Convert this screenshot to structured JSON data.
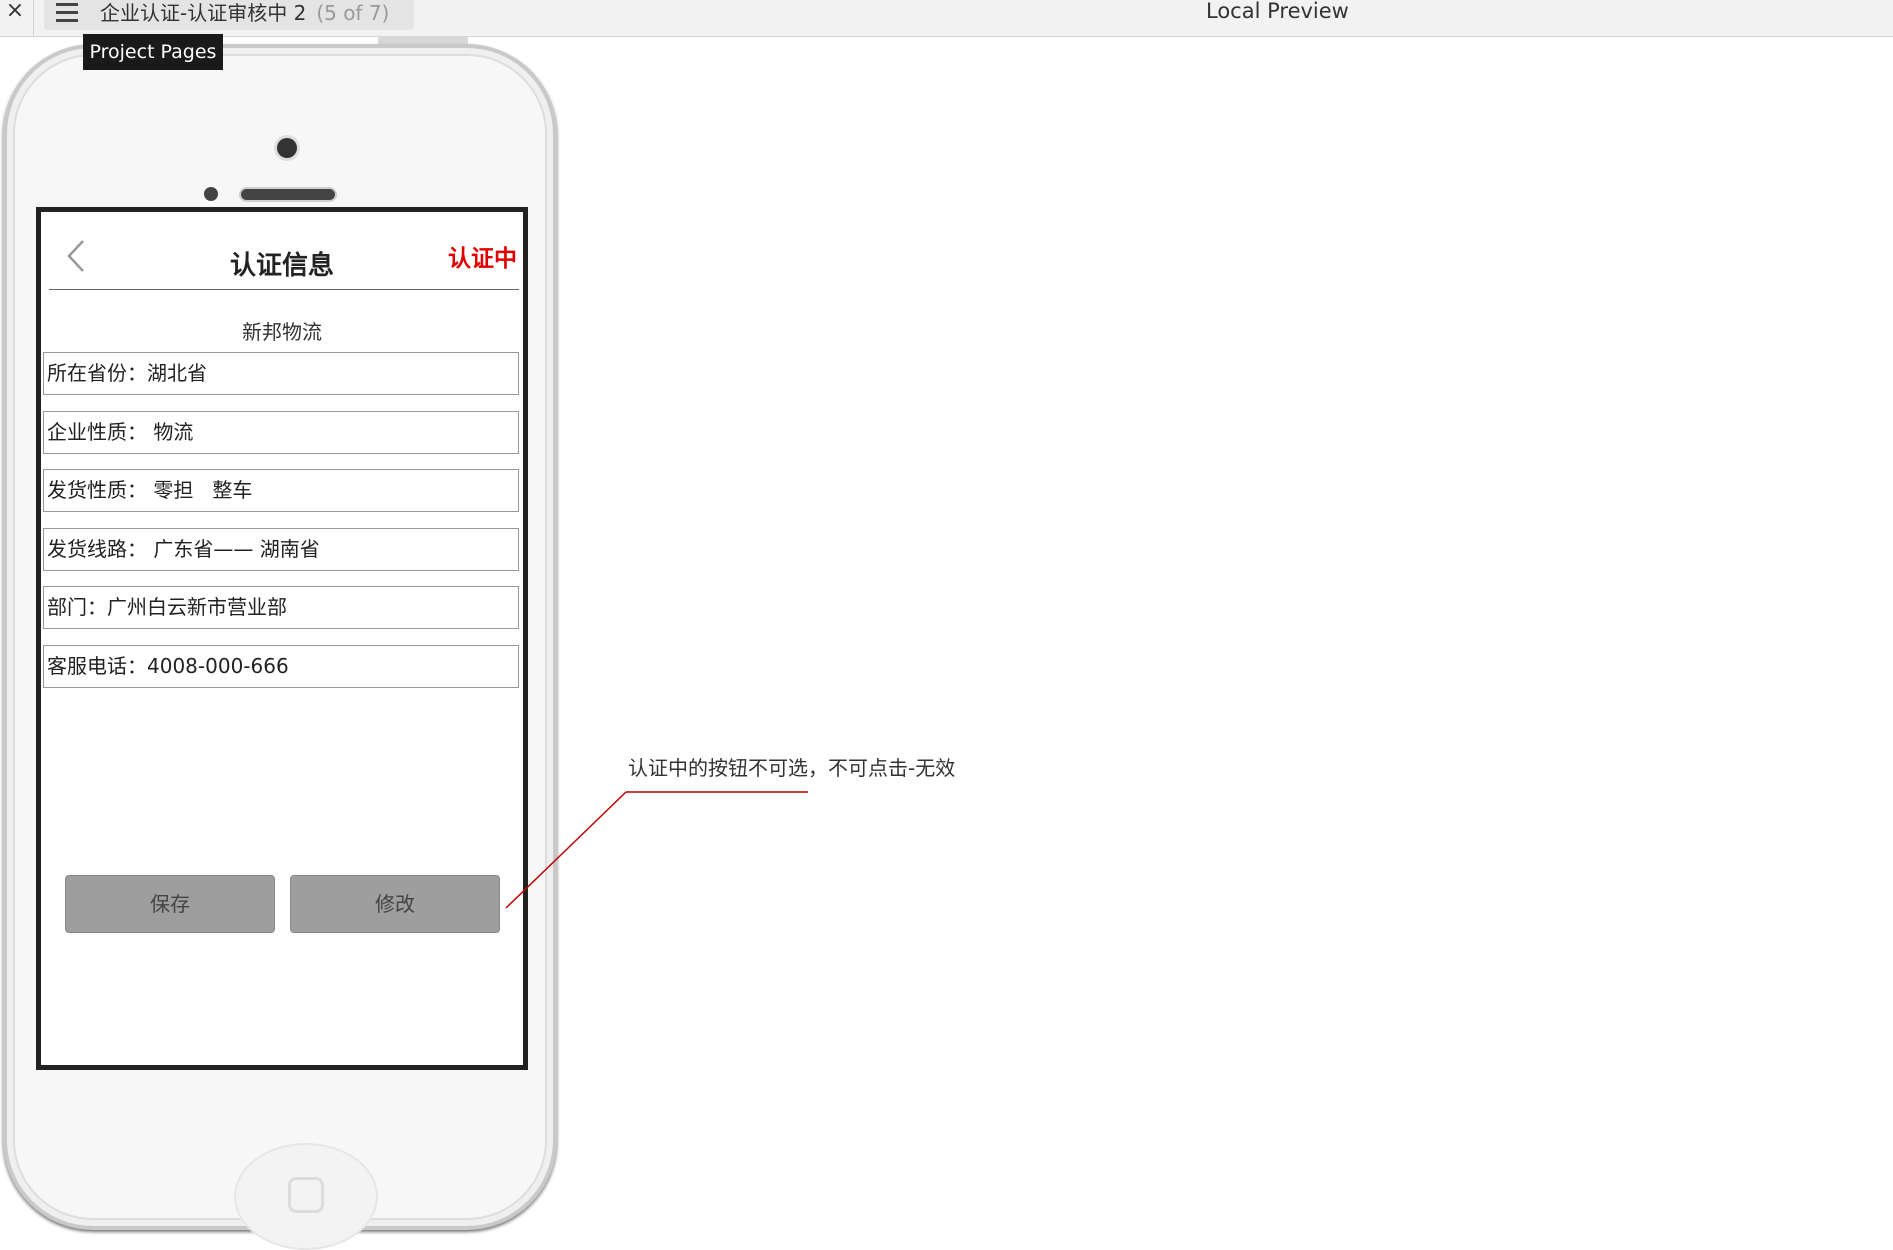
{
  "toolbar": {
    "close_glyph": "×",
    "page_title": "企业认证-认证审核中 2",
    "page_count": "(5 of 7)",
    "preview_label": "Local Preview",
    "tooltip": "Project Pages"
  },
  "screen": {
    "title": "认证信息",
    "status": "认证中",
    "status_color": "#e00000",
    "company": "新邦物流",
    "rows": [
      "所在省份：湖北省",
      "企业性质： 物流",
      "发货性质： 零担   整车",
      "发货线路： 广东省—— 湖南省",
      "部门：广州白云新市营业部",
      "客服电话：4008-000-666"
    ],
    "save_label": "保存",
    "edit_label": "修改",
    "buttons_enabled": false
  },
  "annotation": {
    "text": "认证中的按钮不可选，不可点击-无效",
    "line_color": "#c00000"
  }
}
